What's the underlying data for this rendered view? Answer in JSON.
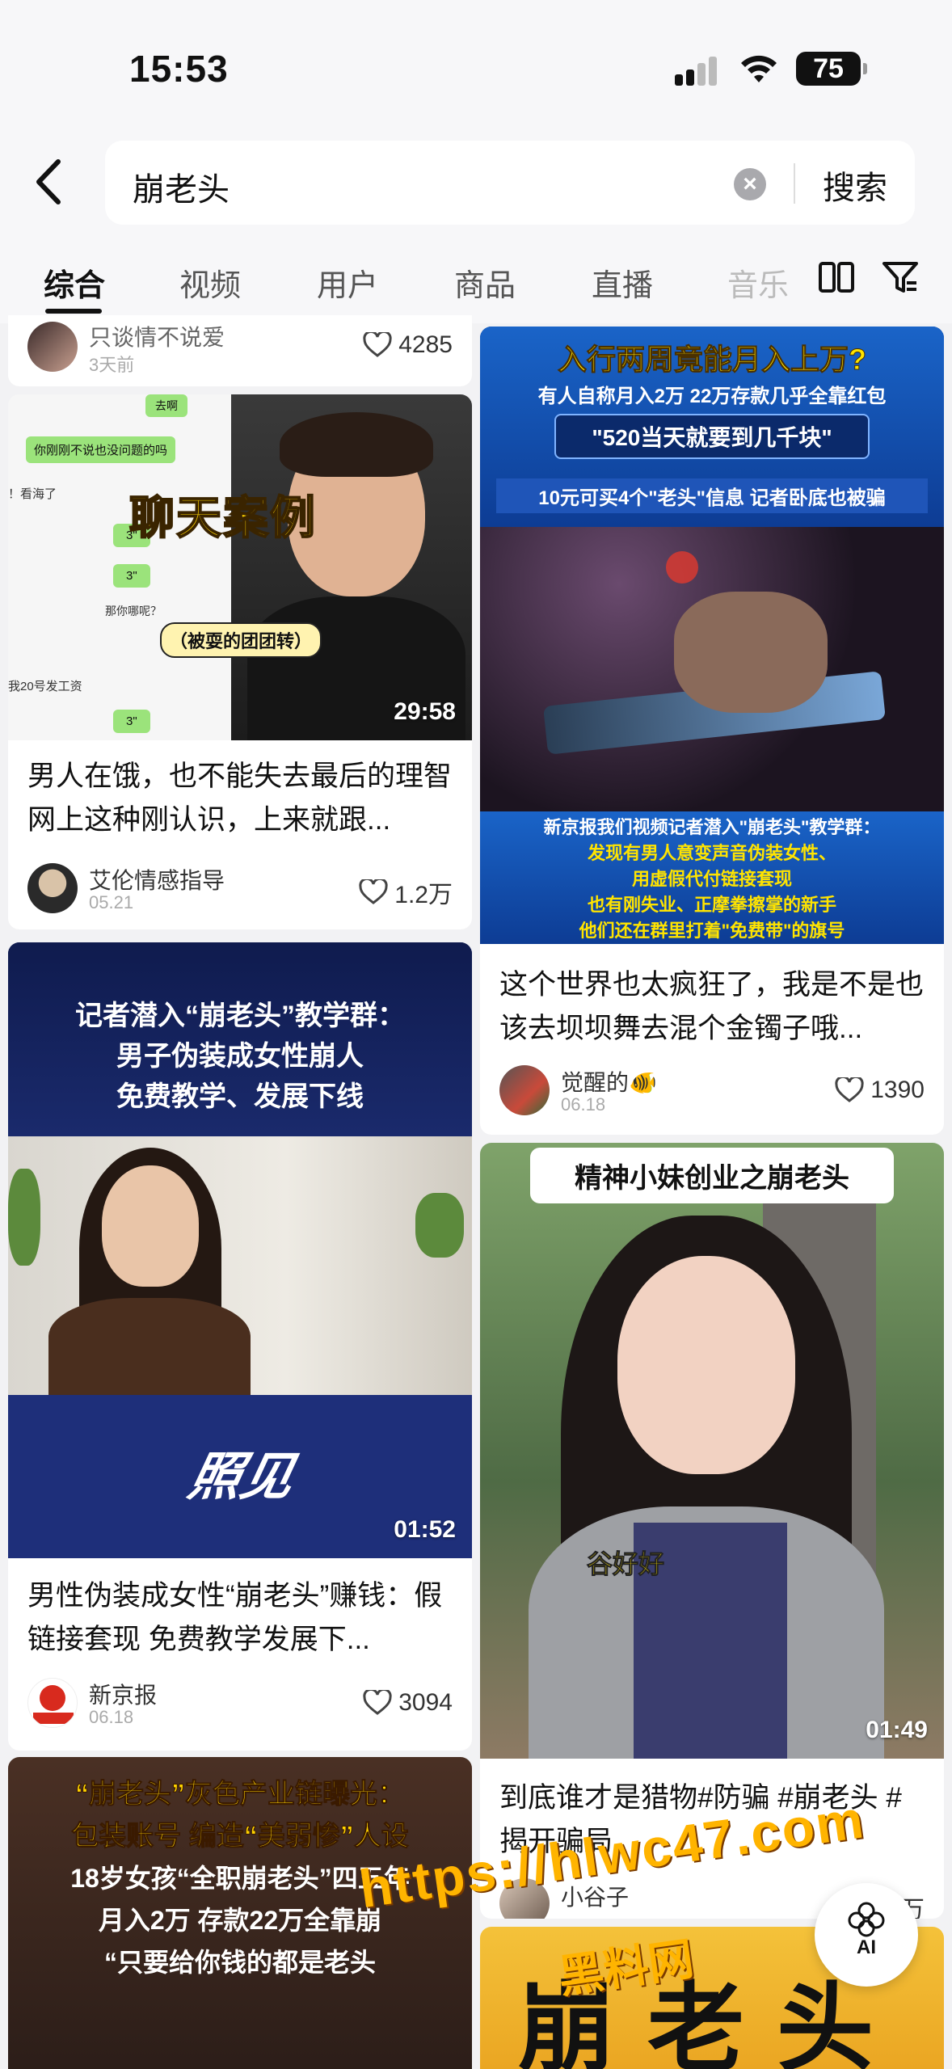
{
  "status_bar": {
    "time": "15:53",
    "battery": "75"
  },
  "search": {
    "query": "崩老头",
    "button_label": "搜索"
  },
  "tabs": [
    {
      "label": "综合"
    },
    {
      "label": "视频"
    },
    {
      "label": "用户"
    },
    {
      "label": "商品"
    },
    {
      "label": "直播"
    },
    {
      "label": "音乐"
    }
  ],
  "left_column": [
    {
      "author": "只谈情不说爱",
      "date": "3天前",
      "likes": "4285"
    },
    {
      "thumb_caption": "聊天案例",
      "thumb_sub": "（被耍的团团转）",
      "chat_bubbles": [
        "去啊",
        "你刚刚不说也没问题的吗",
        "3\"",
        "3\"",
        "那你哪呢？",
        "3\""
      ],
      "chat_side_text": [
        "！看海了",
        "我20号发工资"
      ],
      "duration": "29:58",
      "title": "男人在饿，也不能失去最后的理智 网上这种刚认识，上来就跟...",
      "author": "艾伦情感指导",
      "date": "05.21",
      "likes": "1.2万"
    },
    {
      "thumb_headline": [
        "记者潜入“崩老头”教学群：",
        "男子伪装成女性崩人",
        "免费教学、发展下线"
      ],
      "thumb_logo": "照见",
      "duration": "01:52",
      "title": "男性伪装成女性“崩老头”赚钱：假链接套现 免费教学发展下...",
      "author": "新京报",
      "date": "06.18",
      "likes": "3094"
    },
    {
      "thumb_headline": [
        "“崩老头”灰色产业链曝光：",
        "包装账号 编造“美弱惨”人设",
        "18岁女孩“全职崩老头”四五年",
        "月入2万 存款22万全靠崩",
        "“只要给你钱的都是老头"
      ]
    }
  ],
  "right_column": [
    {
      "thumb_headline": [
        "入行两周竟能月入上万?",
        "有人自称月入2万 22万存款几乎全靠红包",
        "\"520当天就要到几千块\"",
        "10元可买4个\"老头\"信息 记者卧底也被骗"
      ],
      "thumb_bottom": [
        "新京报我们视频记者潜入\"崩老头\"教学群：",
        "发现有男人意变声音伪装女性、",
        "用虚假代付链接套现",
        "也有刚失业、正摩拳擦掌的新手",
        "他们还在群里打着\"免费带\"的旗号"
      ],
      "title": "这个世界也太疯狂了，我是不是也该去坝坝舞去混个金镯子哦...",
      "author": "觉醒的🐠",
      "date": "06.18",
      "likes": "1390"
    },
    {
      "thumb_headline": [
        "精神小妹创业之崩老头"
      ],
      "thumb_sub": "谷好好",
      "duration": "01:49",
      "title": "到底谁才是猎物#防骗 #崩老头 #揭开骗局",
      "author": "小谷子",
      "likes": "万"
    },
    {
      "thumb_headline": [
        "崩老头"
      ]
    }
  ],
  "watermark": {
    "url": "https://hlwc47.com",
    "name": "黑料网"
  },
  "ai_button": {
    "label": "AI"
  },
  "colors": {
    "accent": "#111111",
    "xinjing_blue": "#1a2a6c",
    "caption_yellow": "#ffd400"
  }
}
